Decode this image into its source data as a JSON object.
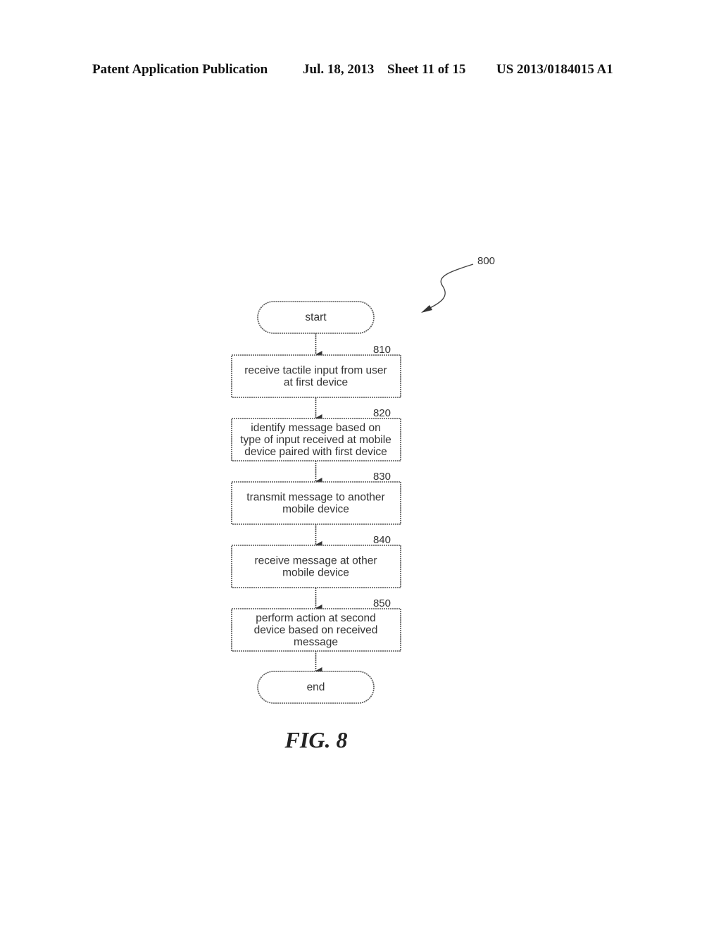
{
  "header": {
    "publication": "Patent Application Publication",
    "date": "Jul. 18, 2013",
    "sheet": "Sheet 11 of 15",
    "number": "US 2013/0184015 A1"
  },
  "figure": {
    "reference": "800",
    "caption": "FIG. 8",
    "start_label": "start",
    "end_label": "end",
    "steps": [
      {
        "ref": "810",
        "lines": [
          "receive tactile input from user",
          "at first device"
        ]
      },
      {
        "ref": "820",
        "lines": [
          "identify message based on",
          "type of input received at mobile",
          "device paired with first device"
        ]
      },
      {
        "ref": "830",
        "lines": [
          "transmit message to another",
          "mobile device"
        ]
      },
      {
        "ref": "840",
        "lines": [
          "receive message at other",
          "mobile device"
        ]
      },
      {
        "ref": "850",
        "lines": [
          "perform action at second",
          "device based on received",
          "message"
        ]
      }
    ]
  }
}
